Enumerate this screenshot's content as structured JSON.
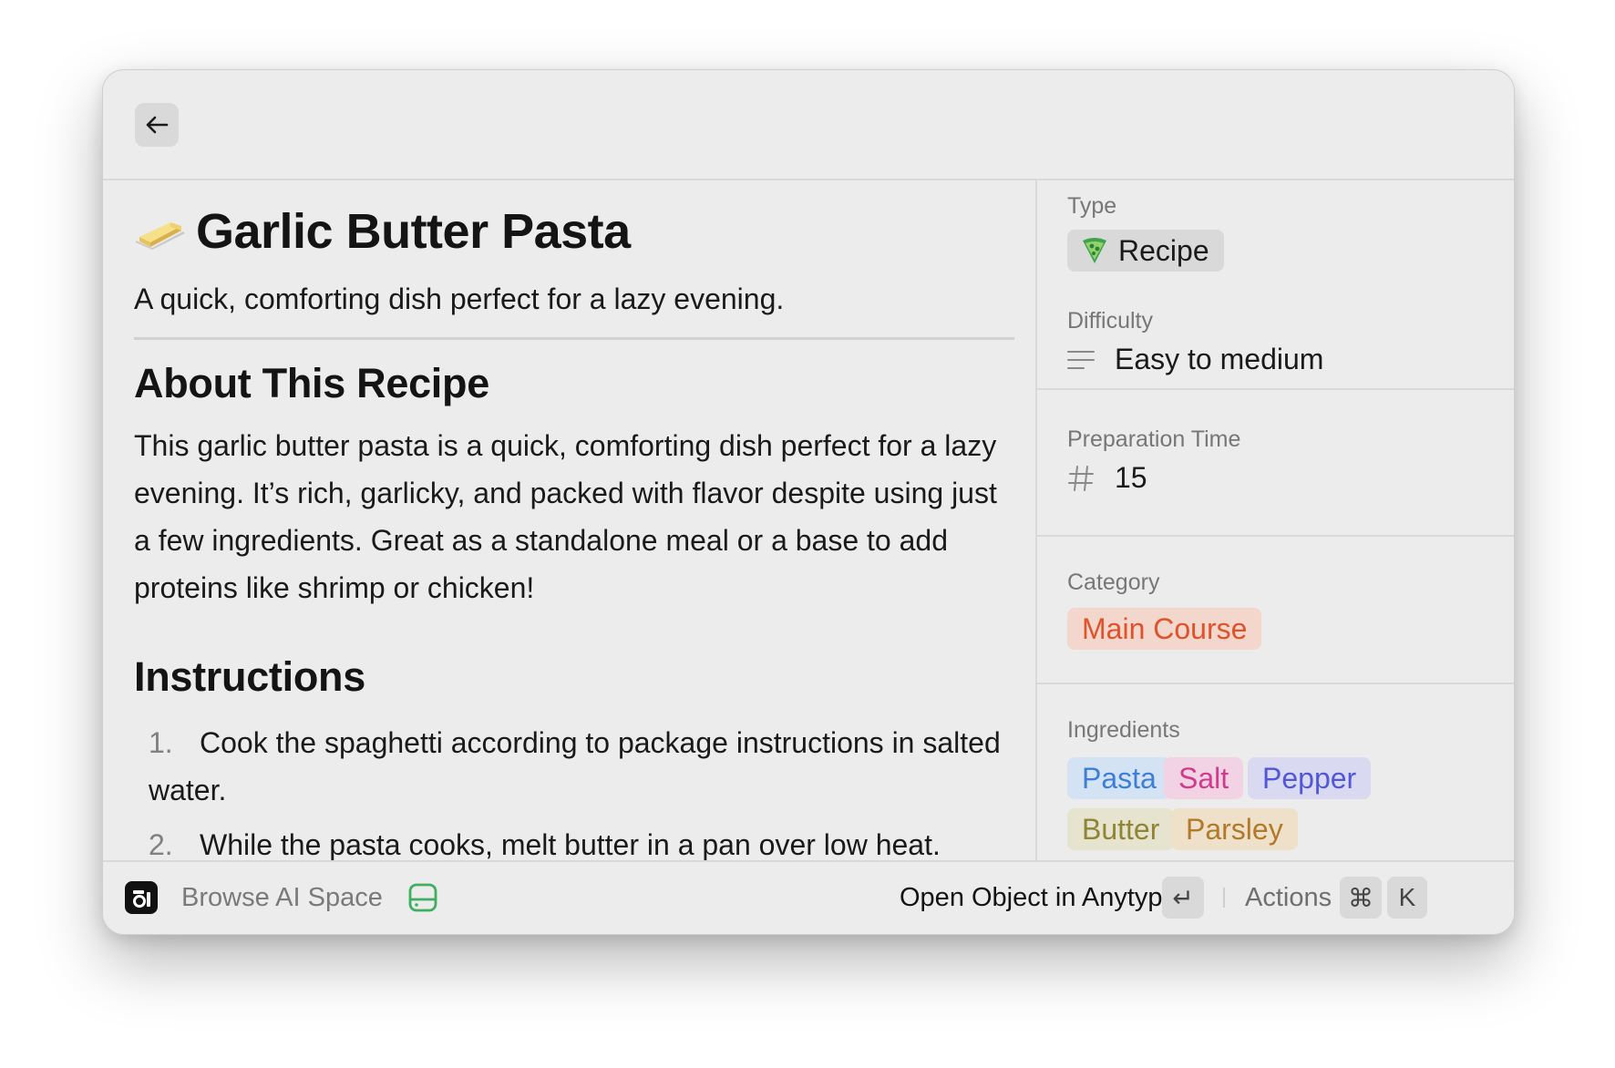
{
  "page": {
    "title": "Garlic Butter Pasta",
    "title_emoji": "butter-emoji",
    "subtitle": "A quick, comforting dish perfect for a lazy evening.",
    "about_heading": "About This Recipe",
    "about_text": "This garlic butter pasta is a quick, comforting dish perfect for a lazy evening. It’s rich, garlicky, and packed with flavor despite using just a few ingredients. Great as a standalone meal or a base to add proteins like shrimp or chicken!",
    "instructions_heading": "Instructions",
    "instructions": [
      {
        "number": "1.",
        "text": "Cook the spaghetti according to package instructions in salted water."
      },
      {
        "number": "2.",
        "text": "While the pasta cooks, melt butter in a pan over low heat."
      }
    ]
  },
  "sidebar": {
    "type_label": "Type",
    "type_value": "Recipe",
    "difficulty_label": "Difficulty",
    "difficulty_value": "Easy to medium",
    "prep_label": "Preparation Time",
    "prep_value": "15",
    "category_label": "Category",
    "category_value": "Main Course",
    "ingredients_label": "Ingredients",
    "ingredients": [
      {
        "name": "Pasta",
        "color": "#3d7fd6",
        "bg": "#d4e3f3"
      },
      {
        "name": "Salt",
        "color": "#d03a8f",
        "bg": "#f1d3e4"
      },
      {
        "name": "Pepper",
        "color": "#5157d8",
        "bg": "#d9daf2"
      },
      {
        "name": "Butter",
        "color": "#8f8534",
        "bg": "#e6e3cf"
      },
      {
        "name": "Parsley",
        "color": "#b07a2a",
        "bg": "#efe0c9"
      }
    ]
  },
  "footer": {
    "space_label": "Browse AI Space",
    "primary_action": "Open Object in Anytype",
    "enter_key": "↵",
    "actions_label": "Actions",
    "cmd_key": "⌘",
    "k_key": "K"
  },
  "colors": {
    "category_text": "#e0522a",
    "category_bg": "#f3d6cc",
    "storage_icon": "#3fae5f"
  }
}
